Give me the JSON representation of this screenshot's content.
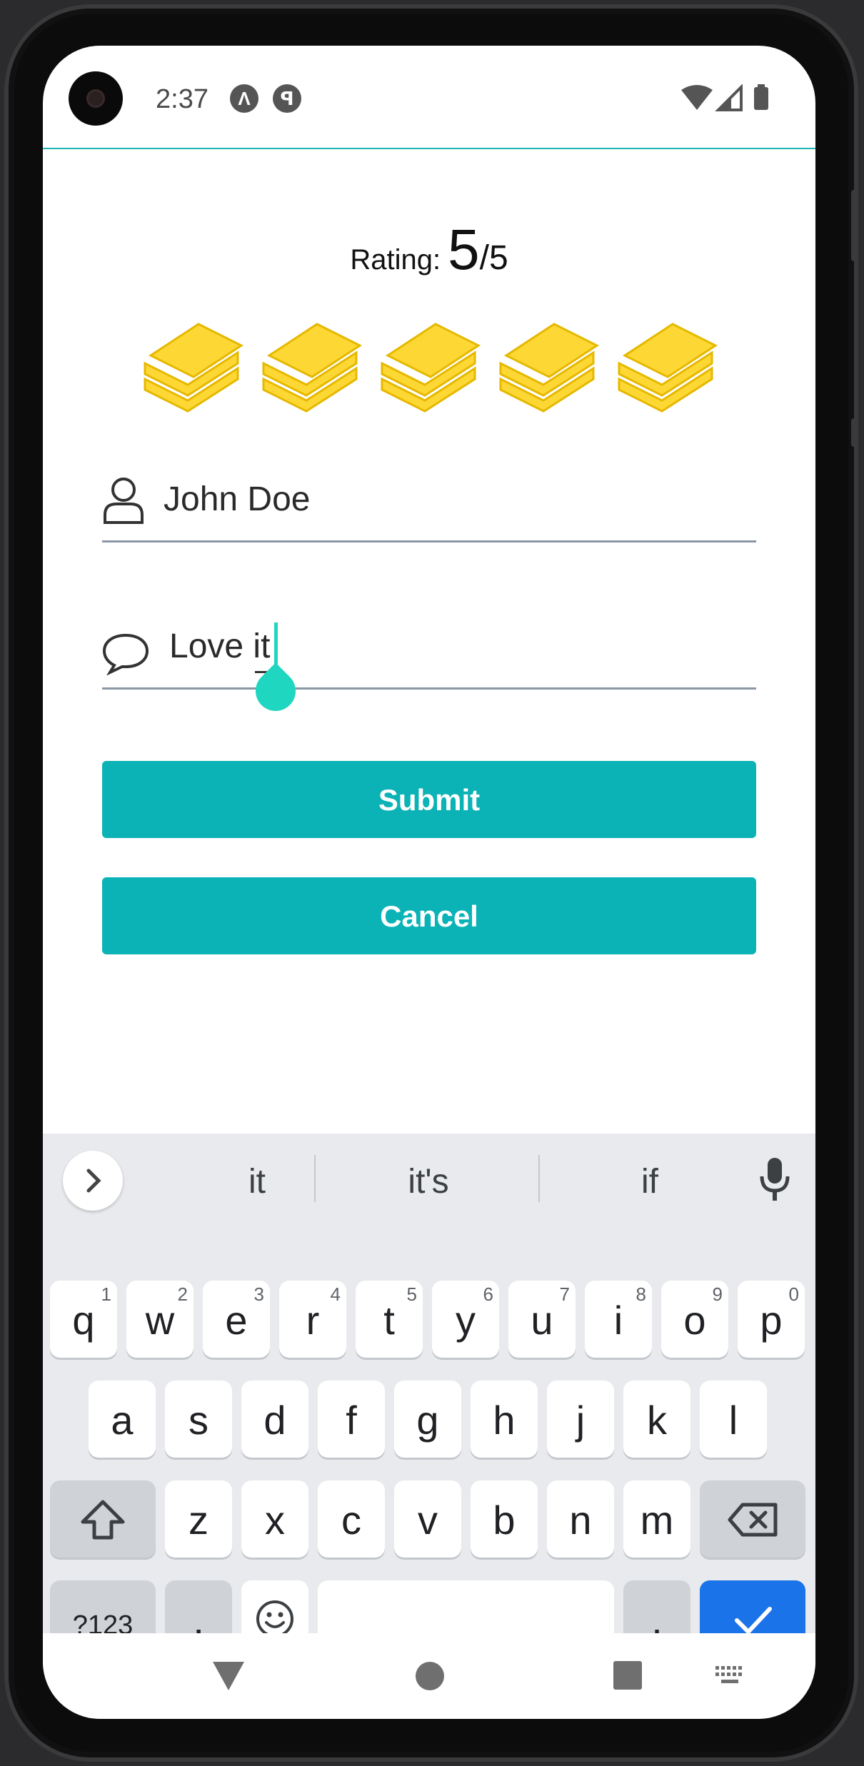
{
  "status_bar": {
    "time": "2:37",
    "icons": [
      "a-notification-icon",
      "p-notification-icon",
      "wifi-icon",
      "signal-icon",
      "battery-icon"
    ]
  },
  "rating": {
    "label": "Rating:",
    "value": "5",
    "max": "/5",
    "count": 5,
    "out_of": 5
  },
  "form": {
    "name_value": "John Doe",
    "comment_value": "Love it"
  },
  "buttons": {
    "submit": "Submit",
    "cancel": "Cancel"
  },
  "keyboard": {
    "suggestions": [
      "it",
      "it's",
      "if"
    ],
    "row1": [
      {
        "k": "q",
        "n": "1"
      },
      {
        "k": "w",
        "n": "2"
      },
      {
        "k": "e",
        "n": "3"
      },
      {
        "k": "r",
        "n": "4"
      },
      {
        "k": "t",
        "n": "5"
      },
      {
        "k": "y",
        "n": "6"
      },
      {
        "k": "u",
        "n": "7"
      },
      {
        "k": "i",
        "n": "8"
      },
      {
        "k": "o",
        "n": "9"
      },
      {
        "k": "p",
        "n": "0"
      }
    ],
    "row2": [
      "a",
      "s",
      "d",
      "f",
      "g",
      "h",
      "j",
      "k",
      "l"
    ],
    "row3": [
      "z",
      "x",
      "c",
      "v",
      "b",
      "n",
      "m"
    ],
    "symbols_label": "?123",
    "comma": ",",
    "period": "."
  },
  "colors": {
    "accent": "#0bb3b6",
    "cursor": "#1fd6c0",
    "book": "#fdd835",
    "enter": "#1a73e8"
  }
}
